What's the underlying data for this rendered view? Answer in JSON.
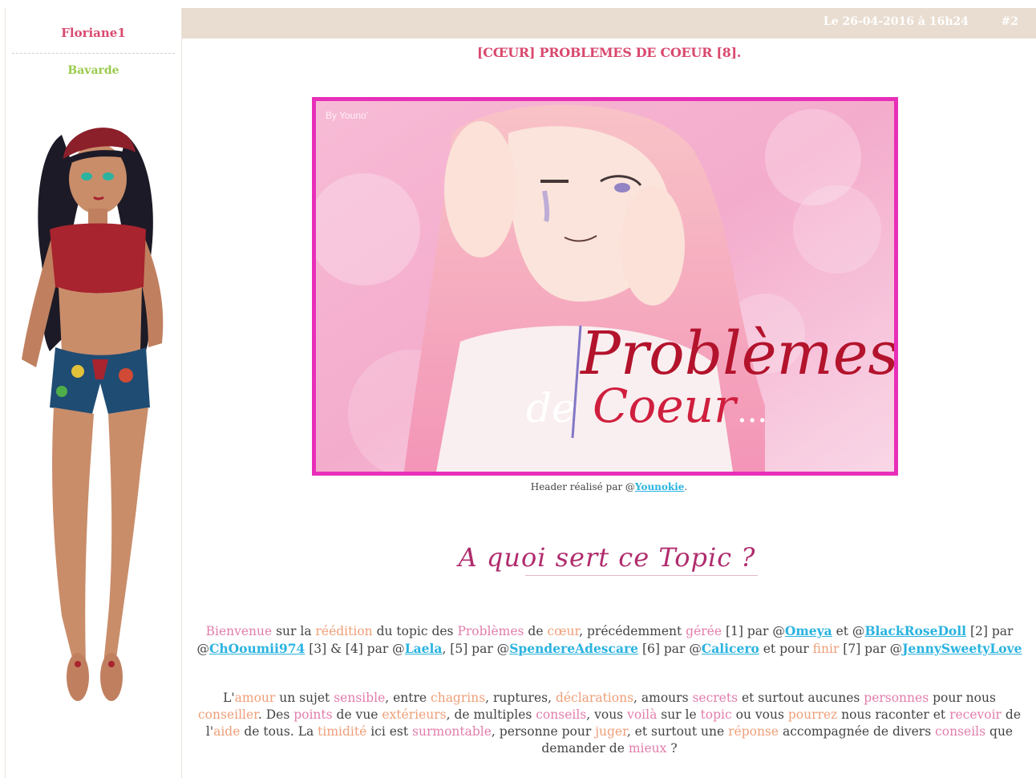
{
  "user": {
    "name": "Floriane1",
    "rank": "Bavarde"
  },
  "post": {
    "date": "Le 26-04-2016 à 16h24",
    "number": "#2",
    "title": "[CŒUR] PROBLEMES DE COEUR [8]."
  },
  "banner": {
    "watermark": "By Youno'",
    "title_line1": "Problèmes",
    "title_de": "de",
    "title_line2": "Coeur",
    "title_dots": "..."
  },
  "credit": {
    "prefix": "Header réalisé par @",
    "author": "Younokie",
    "suffix": "."
  },
  "section_title": "A quoi sert ce Topic ?",
  "intro": {
    "w_bienvenue": "Bienvenue",
    "t1": " sur la ",
    "w_reedition": "réédition",
    "t2": " du topic des ",
    "w_problemes": "Problèmes",
    "t3": " de ",
    "w_coeur": "cœur",
    "t4": ", précédemment ",
    "w_geree": "gérée",
    "t5": " [1] par @",
    "u_omeya": "Omeya",
    "t6": " et @",
    "u_blackrose": "BlackRoseDoll",
    "t7": " [2] par @",
    "u_choumii": "ChOoumii974",
    "t8": " [3] & [4] par @",
    "u_laela": "Laela",
    "t9": ", [5] par @",
    "u_spendere": "SpendereAdescare",
    "t10": " [6] par @",
    "u_calicero": "Calicero",
    "t11": " et pour ",
    "w_finir": "finir",
    "t12": " [7] par @",
    "u_jenny": "JennySweetyLove"
  },
  "desc": {
    "t0": "L'",
    "w_amour": "amour",
    "t1": " un sujet ",
    "w_sensible": "sensible",
    "t2": ", entre ",
    "w_chagrins": "chagrins",
    "t3": ", ruptures, ",
    "w_declarations": "déclarations",
    "t4": ", amours ",
    "w_secrets": "secrets",
    "t5": " et surtout aucunes ",
    "w_personnes": "personnes",
    "t6": " pour nous ",
    "w_conseiller": "conseiller",
    "t7": ". Des ",
    "w_points": "points",
    "t8": " de vue ",
    "w_exterieurs": "extérieurs",
    "t9": ", de multiples ",
    "w_conseils": "conseils",
    "t10": ", vous ",
    "w_voila": "voilà",
    "t11": " sur le ",
    "w_topic": "topic",
    "t12": " ou vous ",
    "w_pourrez": "pourrez",
    "t13": " nous raconter et ",
    "w_recevoir": "recevoir",
    "t14": " de l'",
    "w_aide": "aide",
    "t15": " de tous. La ",
    "w_timidite": "timidité",
    "t16": " ici est ",
    "w_surmontable": "surmontable",
    "t17": ", personne pour ",
    "w_juger": "juger",
    "t18": ", et surtout une ",
    "w_reponse": "réponse",
    "t19": " accompagnée de divers ",
    "w_conseils2": "conseils",
    "t20": " que demander de ",
    "w_mieux": "mieux",
    "t21": " ?"
  },
  "colors": {
    "accent_pink": "#d9496e",
    "rank_green": "#9acb4c",
    "link_blue": "#2ab3e0",
    "header_beige": "#e9ddd1",
    "banner_border": "#e82fb9"
  }
}
